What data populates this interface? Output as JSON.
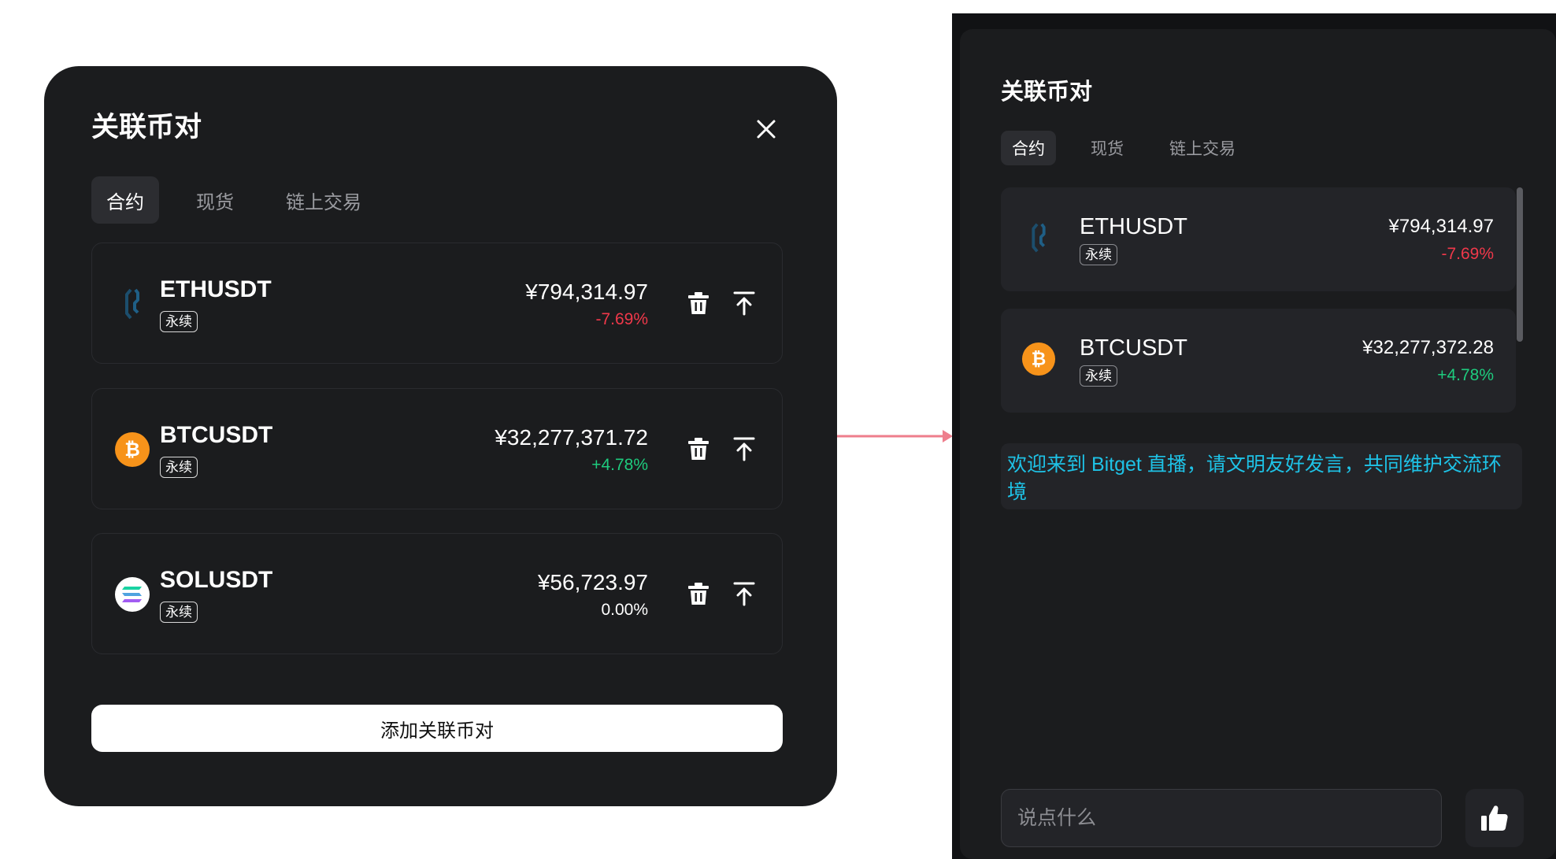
{
  "modal": {
    "title": "关联币对",
    "tabs": [
      {
        "label": "合约",
        "active": true
      },
      {
        "label": "现货",
        "active": false
      },
      {
        "label": "链上交易",
        "active": false
      }
    ],
    "pairs": [
      {
        "symbol": "ETHUSDT",
        "badge": "永续",
        "price": "¥794,314.97",
        "change": "-7.69%",
        "icon": "eth-icon"
      },
      {
        "symbol": "BTCUSDT",
        "badge": "永续",
        "price": "¥32,277,371.72",
        "change": "+4.78%",
        "icon": "btc-icon"
      },
      {
        "symbol": "SOLUSDT",
        "badge": "永续",
        "price": "¥56,723.97",
        "change": "0.00%",
        "icon": "sol-icon"
      }
    ],
    "add_button": "添加关联币对"
  },
  "panel": {
    "title": "关联币对",
    "tabs": [
      {
        "label": "合约",
        "active": true
      },
      {
        "label": "现货",
        "active": false
      },
      {
        "label": "链上交易",
        "active": false
      }
    ],
    "pairs": [
      {
        "symbol": "ETHUSDT",
        "badge": "永续",
        "price": "¥794,314.97",
        "change": "-7.69%",
        "icon": "eth-icon"
      },
      {
        "symbol": "BTCUSDT",
        "badge": "永续",
        "price": "¥32,277,372.28",
        "change": "+4.78%",
        "icon": "btc-icon"
      }
    ],
    "welcome": "欢迎来到 Bitget 直播，请文明友好发言，共同维护交流环境",
    "chat_placeholder": "说点什么"
  },
  "colors": {
    "negative": "#f0384a",
    "positive": "#1ecb7e",
    "welcome_text": "#1ec2e6",
    "arrow": "#ee7e8c",
    "btc": "#f7931a"
  },
  "icons": [
    "close-icon",
    "trash-icon",
    "pin-to-top-icon",
    "thumbs-up-icon",
    "arrow-right-icon"
  ]
}
